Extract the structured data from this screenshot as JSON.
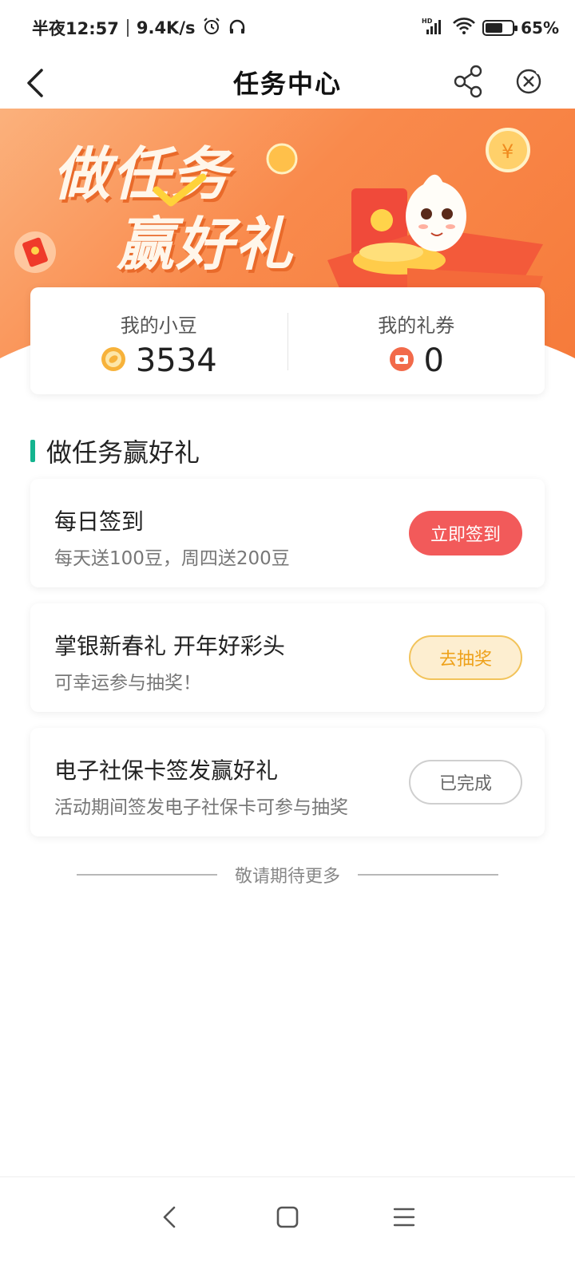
{
  "status_bar": {
    "time": "半夜12:57",
    "speed": "9.4K/s",
    "battery_pct": "65%",
    "battery_level": 0.65,
    "icons": [
      "alarm-icon",
      "headphones-icon",
      "hd-signal-icon",
      "wifi-icon",
      "battery-icon"
    ]
  },
  "nav": {
    "title": "任务中心",
    "icons": [
      "back-arrow-icon",
      "share-icon",
      "close-circle-icon"
    ]
  },
  "banner": {
    "line1": "做任务",
    "line2": "赢好礼"
  },
  "summary": {
    "beans_label": "我的小豆",
    "beans_value": "3534",
    "coupons_label": "我的礼券",
    "coupons_value": "0"
  },
  "section": {
    "title": "做任务赢好礼"
  },
  "tasks": [
    {
      "title": "每日签到",
      "desc": "每天送100豆，周四送200豆",
      "button": "立即签到"
    },
    {
      "title": "掌银新春礼 开年好彩头",
      "desc": "可幸运参与抽奖！",
      "button": "去抽奖"
    },
    {
      "title": "电子社保卡签发赢好礼",
      "desc": "活动期间签发电子社保卡可参与抽奖",
      "button": "已完成"
    }
  ],
  "footer": {
    "end_text": "敬请期待更多"
  },
  "colors": {
    "accent_green": "#14b48f",
    "signin_red": "#f25a5a",
    "draw_yellow": "#eea11a",
    "banner_orange": "#f98a4c"
  }
}
